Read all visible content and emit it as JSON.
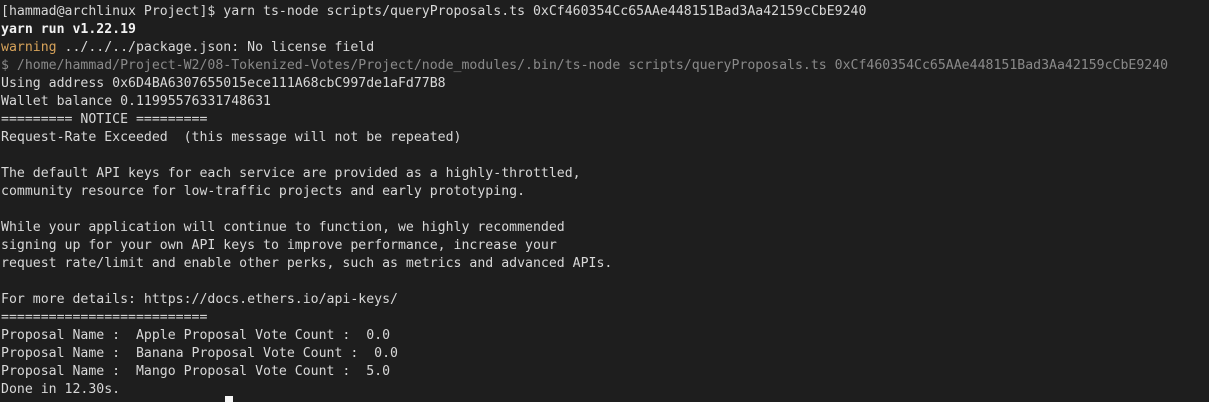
{
  "terminal": {
    "lines": [
      {
        "style": "normal",
        "text": "[hammad@archlinux Project]$ yarn ts-node scripts/queryProposals.ts 0xCf460354Cc65AAe448151Bad3Aa42159cCbE9240"
      },
      {
        "style": "bold",
        "text": "yarn run v1.22.19"
      },
      {
        "style": "warning",
        "prefix": "warning",
        "text": " ../../../package.json: No license field"
      },
      {
        "style": "dim",
        "text": "$ /home/hammad/Project-W2/08-Tokenized-Votes/Project/node_modules/.bin/ts-node scripts/queryProposals.ts 0xCf460354Cc65AAe448151Bad3Aa42159cCbE9240"
      },
      {
        "style": "normal",
        "text": "Using address 0x6D4BA6307655015ece111A68cbC997de1aFd77B8"
      },
      {
        "style": "normal",
        "text": "Wallet balance 0.11995576331748631"
      },
      {
        "style": "normal",
        "text": "========= NOTICE ========="
      },
      {
        "style": "normal",
        "text": "Request-Rate Exceeded  (this message will not be repeated)"
      },
      {
        "style": "normal",
        "text": ""
      },
      {
        "style": "normal",
        "text": "The default API keys for each service are provided as a highly-throttled,"
      },
      {
        "style": "normal",
        "text": "community resource for low-traffic projects and early prototyping."
      },
      {
        "style": "normal",
        "text": ""
      },
      {
        "style": "normal",
        "text": "While your application will continue to function, we highly recommended"
      },
      {
        "style": "normal",
        "text": "signing up for your own API keys to improve performance, increase your"
      },
      {
        "style": "normal",
        "text": "request rate/limit and enable other perks, such as metrics and advanced APIs."
      },
      {
        "style": "normal",
        "text": ""
      },
      {
        "style": "normal",
        "text": "For more details: https://docs.ethers.io/api-keys/"
      },
      {
        "style": "normal",
        "text": "=========================="
      },
      {
        "style": "normal",
        "text": "Proposal Name :  Apple Proposal Vote Count :  0.0"
      },
      {
        "style": "normal",
        "text": "Proposal Name :  Banana Proposal Vote Count :  0.0"
      },
      {
        "style": "normal",
        "text": "Proposal Name :  Mango Proposal Vote Count :  5.0"
      },
      {
        "style": "normal",
        "text": "Done in 12.30s."
      }
    ]
  },
  "colors": {
    "background": "#1e1e1e",
    "foreground": "#d8d8d8",
    "warning": "#d7a35a",
    "dim": "#8a8a8a",
    "bold": "#f2f2f2"
  }
}
